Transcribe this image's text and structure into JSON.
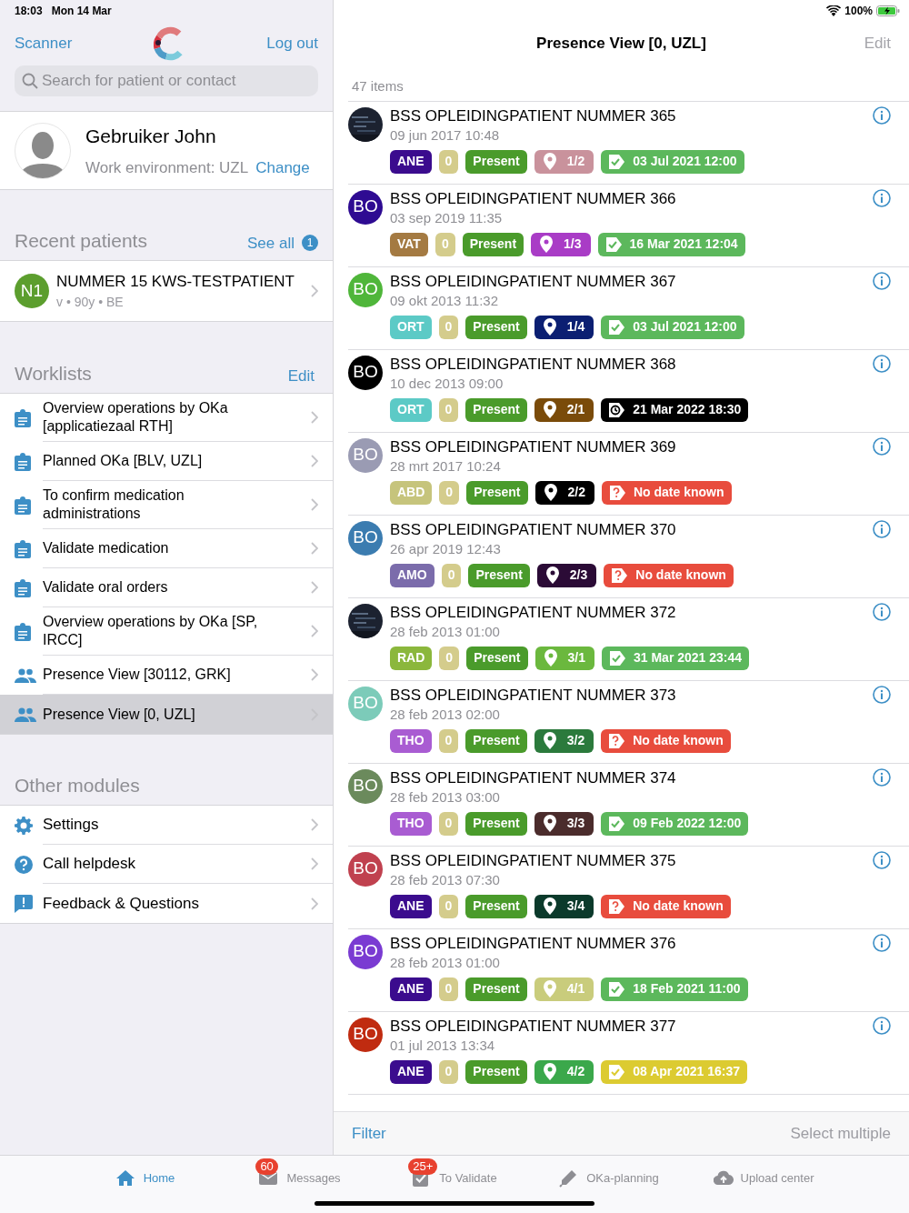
{
  "status_bar": {
    "time": "18:03",
    "date": "Mon 14 Mar",
    "battery": "100%"
  },
  "sidebar": {
    "scanner": "Scanner",
    "logout": "Log out",
    "search": {
      "placeholder": "Search for patient or contact"
    },
    "user": {
      "name": "Gebruiker John",
      "environment": "Work environment: UZL",
      "change": "Change"
    },
    "recent": {
      "title": "Recent patients",
      "see_all": "See all",
      "count": "1",
      "patients": [
        {
          "initials": "N1",
          "color": "#5c9e2e",
          "name": "NUMMER 15 KWS-TESTPATIENT",
          "details": "v • 90y • BE"
        }
      ]
    },
    "worklists": {
      "title": "Worklists",
      "edit": "Edit",
      "items": [
        {
          "kind": "clipboard",
          "label": "Overview operations by OKa [applicatiezaal RTH]",
          "selected": false
        },
        {
          "kind": "clipboard",
          "label": "Planned OKa [BLV, UZL]",
          "selected": false
        },
        {
          "kind": "clipboard",
          "label": "To confirm medication administrations",
          "selected": false
        },
        {
          "kind": "clipboard",
          "label": "Validate medication",
          "selected": false
        },
        {
          "kind": "clipboard",
          "label": "Validate oral orders",
          "selected": false
        },
        {
          "kind": "clipboard",
          "label": "Overview operations by OKa [SP, IRCC]",
          "selected": false
        },
        {
          "kind": "people",
          "label": "Presence View [30112, GRK]",
          "selected": false
        },
        {
          "kind": "people",
          "label": "Presence View [0, UZL]",
          "selected": true
        }
      ]
    },
    "modules": {
      "title": "Other modules",
      "items": [
        {
          "kind": "gear",
          "label": "Settings"
        },
        {
          "kind": "help",
          "label": "Call helpdesk"
        },
        {
          "kind": "feedback",
          "label": "Feedback & Questions"
        }
      ]
    }
  },
  "main": {
    "title": "Presence View [0, UZL]",
    "edit": {
      "label": "Edit",
      "disabled": true
    },
    "count": "47 items",
    "patients": [
      {
        "name": "BSS OPLEIDINGPATIENT NUMMER 365",
        "date": "09 jun 2017 10:48",
        "dept": {
          "text": "ANE",
          "color": "#3b0c8e"
        },
        "counter": "0",
        "status": "Present",
        "location": {
          "text": "1/2",
          "color": "#c9929c"
        },
        "due": {
          "kind": "done",
          "text": "03 Jul 2021 12:00",
          "color": "#5cb85c"
        }
      },
      {
        "avatar": {
          "kind": "initials",
          "text": "BO",
          "color": "#2e0b92"
        },
        "name": "BSS OPLEIDINGPATIENT NUMMER 366",
        "date": "03 sep 2019 11:35",
        "dept": {
          "text": "VAT",
          "color": "#a47a42"
        },
        "counter": "0",
        "status": "Present",
        "location": {
          "text": "1/3",
          "color": "#a93cc6"
        },
        "due": {
          "kind": "done",
          "text": "16 Mar 2021 12:04",
          "color": "#5cb85c"
        }
      },
      {
        "avatar": {
          "kind": "initials",
          "text": "BO",
          "color": "#4fb63a"
        },
        "name": "BSS OPLEIDINGPATIENT NUMMER 367",
        "date": "09 okt 2013 11:32",
        "dept": {
          "text": "ORT",
          "color": "#5ccac6"
        },
        "counter": "0",
        "status": "Present",
        "location": {
          "text": "1/4",
          "color": "#0b1f72"
        },
        "due": {
          "kind": "done",
          "text": "03 Jul 2021 12:00",
          "color": "#5cb85c"
        }
      },
      {
        "avatar": {
          "kind": "initials",
          "text": "BO",
          "color": "#000000"
        },
        "name": "BSS OPLEIDINGPATIENT NUMMER 368",
        "date": "10 dec 2013 09:00",
        "dept": {
          "text": "ORT",
          "color": "#5ccac6"
        },
        "counter": "0",
        "status": "Present",
        "location": {
          "text": "2/1",
          "color": "#7a4b0a"
        },
        "due": {
          "kind": "clock",
          "text": "21 Mar 2022 18:30",
          "color": "#000000"
        }
      },
      {
        "avatar": {
          "kind": "initials",
          "text": "BO",
          "color": "#9a9bb3"
        },
        "name": "BSS OPLEIDINGPATIENT NUMMER 369",
        "date": "28 mrt 2017 10:24",
        "dept": {
          "text": "ABD",
          "color": "#c6c47c"
        },
        "counter": "0",
        "status": "Present",
        "location": {
          "text": "2/2",
          "color": "#000000"
        },
        "due": {
          "kind": "unknown",
          "text": "No date known",
          "color": "#e84c3d"
        }
      },
      {
        "avatar": {
          "kind": "initials",
          "text": "BO",
          "color": "#3b7cb0"
        },
        "name": "BSS OPLEIDINGPATIENT NUMMER 370",
        "date": "26 apr 2019 12:43",
        "dept": {
          "text": "AMO",
          "color": "#7b6cab"
        },
        "counter": "0",
        "status": "Present",
        "location": {
          "text": "2/3",
          "color": "#2b0b36"
        },
        "due": {
          "kind": "unknown",
          "text": "No date known",
          "color": "#e84c3d"
        }
      },
      {
        "name": "BSS OPLEIDINGPATIENT NUMMER 372",
        "date": "28 feb 2013 01:00",
        "dept": {
          "text": "RAD",
          "color": "#8bb73c"
        },
        "counter": "0",
        "status": "Present",
        "location": {
          "text": "3/1",
          "color": "#6bb83e"
        },
        "due": {
          "kind": "done",
          "text": "31 Mar 2021 23:44",
          "color": "#5cb85c"
        }
      },
      {
        "avatar": {
          "kind": "initials",
          "text": "BO",
          "color": "#7ccbb9"
        },
        "name": "BSS OPLEIDINGPATIENT NUMMER 373",
        "date": "28 feb 2013 02:00",
        "dept": {
          "text": "THO",
          "color": "#a95cd2"
        },
        "counter": "0",
        "status": "Present",
        "location": {
          "text": "3/2",
          "color": "#2b7a3c"
        },
        "due": {
          "kind": "unknown",
          "text": "No date known",
          "color": "#e84c3d"
        }
      },
      {
        "avatar": {
          "kind": "initials",
          "text": "BO",
          "color": "#6b8a5c"
        },
        "name": "BSS OPLEIDINGPATIENT NUMMER 374",
        "date": "28 feb 2013 03:00",
        "dept": {
          "text": "THO",
          "color": "#a95cd2"
        },
        "counter": "0",
        "status": "Present",
        "location": {
          "text": "3/3",
          "color": "#4b2c2c"
        },
        "due": {
          "kind": "done",
          "text": "09 Feb 2022 12:00",
          "color": "#5cb85c"
        }
      },
      {
        "avatar": {
          "kind": "initials",
          "text": "BO",
          "color": "#c0414f"
        },
        "name": "BSS OPLEIDINGPATIENT NUMMER 375",
        "date": "28 feb 2013 07:30",
        "dept": {
          "text": "ANE",
          "color": "#3b0c8e"
        },
        "counter": "0",
        "status": "Present",
        "location": {
          "text": "3/4",
          "color": "#0b3a2b"
        },
        "due": {
          "kind": "unknown",
          "text": "No date known",
          "color": "#e84c3d"
        }
      },
      {
        "avatar": {
          "kind": "initials",
          "text": "BO",
          "color": "#7a3bd2"
        },
        "name": "BSS OPLEIDINGPATIENT NUMMER 376",
        "date": "28 feb 2013 01:00",
        "dept": {
          "text": "ANE",
          "color": "#3b0c8e"
        },
        "counter": "0",
        "status": "Present",
        "location": {
          "text": "4/1",
          "color": "#c9cc7c"
        },
        "due": {
          "kind": "done",
          "text": "18 Feb 2021 11:00",
          "color": "#5cb85c"
        }
      },
      {
        "avatar": {
          "kind": "initials",
          "text": "BO",
          "color": "#c02b10"
        },
        "name": "BSS OPLEIDINGPATIENT NUMMER 377",
        "date": "01 jul 2013 13:34",
        "dept": {
          "text": "ANE",
          "color": "#3b0c8e"
        },
        "counter": "0",
        "status": "Present",
        "location": {
          "text": "4/2",
          "color": "#3ba84b"
        },
        "due": {
          "kind": "done",
          "text": "08 Apr 2021 16:37",
          "color": "#dccb31"
        }
      }
    ],
    "filter": "Filter",
    "select_multiple": {
      "label": "Select multiple",
      "disabled": true
    }
  },
  "tab_bar": [
    {
      "kind": "home",
      "label": "Home",
      "selected": true
    },
    {
      "kind": "mail",
      "label": "Messages",
      "badge": "60",
      "selected": false
    },
    {
      "kind": "check",
      "label": "To Validate",
      "badge": "25+",
      "selected": false
    },
    {
      "kind": "pencil",
      "label": "OKa-planning",
      "selected": false
    },
    {
      "kind": "upload",
      "label": "Upload center",
      "selected": false
    }
  ]
}
